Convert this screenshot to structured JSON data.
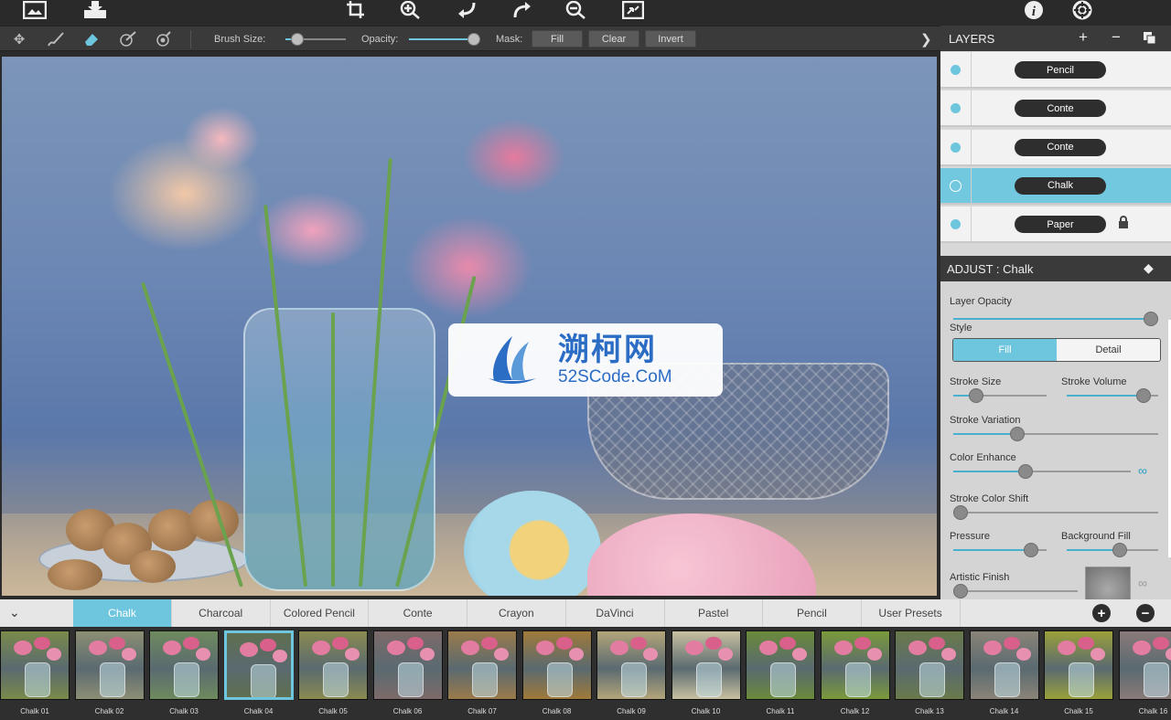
{
  "toolbar": {
    "brush_size_label": "Brush Size:",
    "brush_size": 0.12,
    "opacity_label": "Opacity:",
    "opacity": 1.0,
    "mask_label": "Mask:",
    "fill_label": "Fill",
    "clear_label": "Clear",
    "invert_label": "Invert"
  },
  "watermark": {
    "title": "溯柯网",
    "subtitle": "52SCode.CoM"
  },
  "layers": {
    "title": "LAYERS",
    "items": [
      {
        "label": "Pencil",
        "selected": false,
        "locked": false
      },
      {
        "label": "Conte",
        "selected": false,
        "locked": false
      },
      {
        "label": "Conte",
        "selected": false,
        "locked": false
      },
      {
        "label": "Chalk",
        "selected": true,
        "locked": false
      },
      {
        "label": "Paper",
        "selected": false,
        "locked": true
      }
    ]
  },
  "adjust": {
    "title": "ADJUST : Chalk",
    "layer_opacity_label": "Layer Opacity",
    "layer_opacity": 1.0,
    "style_label": "Style",
    "style_fill": "Fill",
    "style_detail": "Detail",
    "stroke_size_label": "Stroke Size",
    "stroke_size": 0.2,
    "stroke_volume_label": "Stroke Volume",
    "stroke_volume": 0.9,
    "stroke_variation_label": "Stroke Variation",
    "stroke_variation": 0.3,
    "color_enhance_label": "Color Enhance",
    "color_enhance": 0.4,
    "stroke_color_shift_label": "Stroke Color Shift",
    "stroke_color_shift": 0.0,
    "pressure_label": "Pressure",
    "pressure": 0.9,
    "background_fill_label": "Background Fill",
    "background_fill": 0.6,
    "artistic_finish_label": "Artistic Finish",
    "artistic_finish": 0.0
  },
  "preset_tabs": [
    "Chalk",
    "Charcoal",
    "Colored Pencil",
    "Conte",
    "Crayon",
    "DaVinci",
    "Pastel",
    "Pencil",
    "User Presets"
  ],
  "active_tab": "Chalk",
  "presets": [
    "Chalk 01",
    "Chalk 02",
    "Chalk 03",
    "Chalk 04",
    "Chalk 05",
    "Chalk 06",
    "Chalk 07",
    "Chalk 08",
    "Chalk 09",
    "Chalk 10",
    "Chalk 11",
    "Chalk 12",
    "Chalk 13",
    "Chalk 14",
    "Chalk 15",
    "Chalk 16"
  ],
  "selected_preset": "Chalk 04",
  "colors": {
    "accent": "#6ec6de"
  }
}
